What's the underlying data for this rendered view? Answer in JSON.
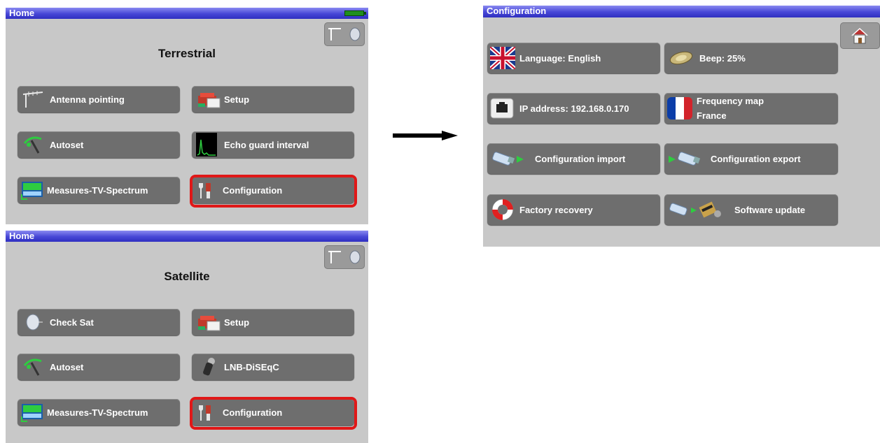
{
  "terrestrial_panel": {
    "title": "Home",
    "heading": "Terrestrial",
    "buttons": {
      "antenna_pointing": "Antenna pointing",
      "setup": "Setup",
      "autoset": "Autoset",
      "echo_guard": "Echo guard interval",
      "measures": "Measures-TV-Spectrum",
      "configuration": "Configuration"
    }
  },
  "satellite_panel": {
    "title": "Home",
    "heading": "Satellite",
    "buttons": {
      "check_sat": "Check Sat",
      "setup": "Setup",
      "autoset": "Autoset",
      "lnb_diseqc": "LNB-DiSEqC",
      "measures": "Measures-TV-Spectrum",
      "configuration": "Configuration"
    }
  },
  "configuration_panel": {
    "title": "Configuration",
    "buttons": {
      "language": "Language: English",
      "beep": "Beep: 25%",
      "ip_address": "IP address: 192.168.0.170",
      "frequency_map_line1": "Frequency map",
      "frequency_map_line2": "France",
      "config_import": "Configuration import",
      "config_export": "Configuration export",
      "factory_recovery": "Factory recovery",
      "software_update": "Software update"
    }
  },
  "colors": {
    "titlebar": "#4646d6",
    "panel_bg": "#c8c8c8",
    "button_bg": "#6e6e6e",
    "highlight": "#e01818"
  },
  "icons": {
    "battery": "battery-icon",
    "mode_toggle": "antenna-dish-icon",
    "home": "home-icon"
  }
}
